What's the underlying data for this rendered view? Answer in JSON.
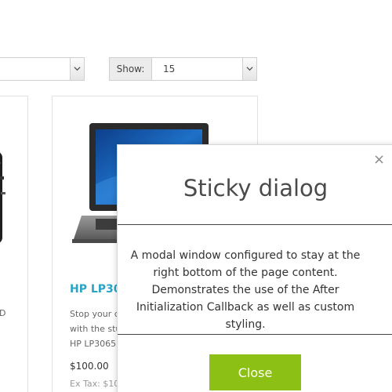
{
  "toolbar": {
    "sort_value": "",
    "show_label": "Show:",
    "show_value": "15"
  },
  "products": [
    {
      "title": "",
      "desc_fragment": "D"
    },
    {
      "title": "HP LP306",
      "description_lines": [
        "Stop your c",
        "with the stu",
        "HP LP3065"
      ],
      "price": "$100.00",
      "tax": "Ex Tax: $10"
    }
  ],
  "dialog": {
    "title": "Sticky dialog",
    "body": "A modal window configured to stay at the right bottom of the page content. Demonstrates the use of the After Initialization Callback as well as custom styling.",
    "close_label": "Close",
    "close_icon": "×"
  },
  "colors": {
    "link": "#2aa3c5",
    "button": "#8cc014"
  }
}
